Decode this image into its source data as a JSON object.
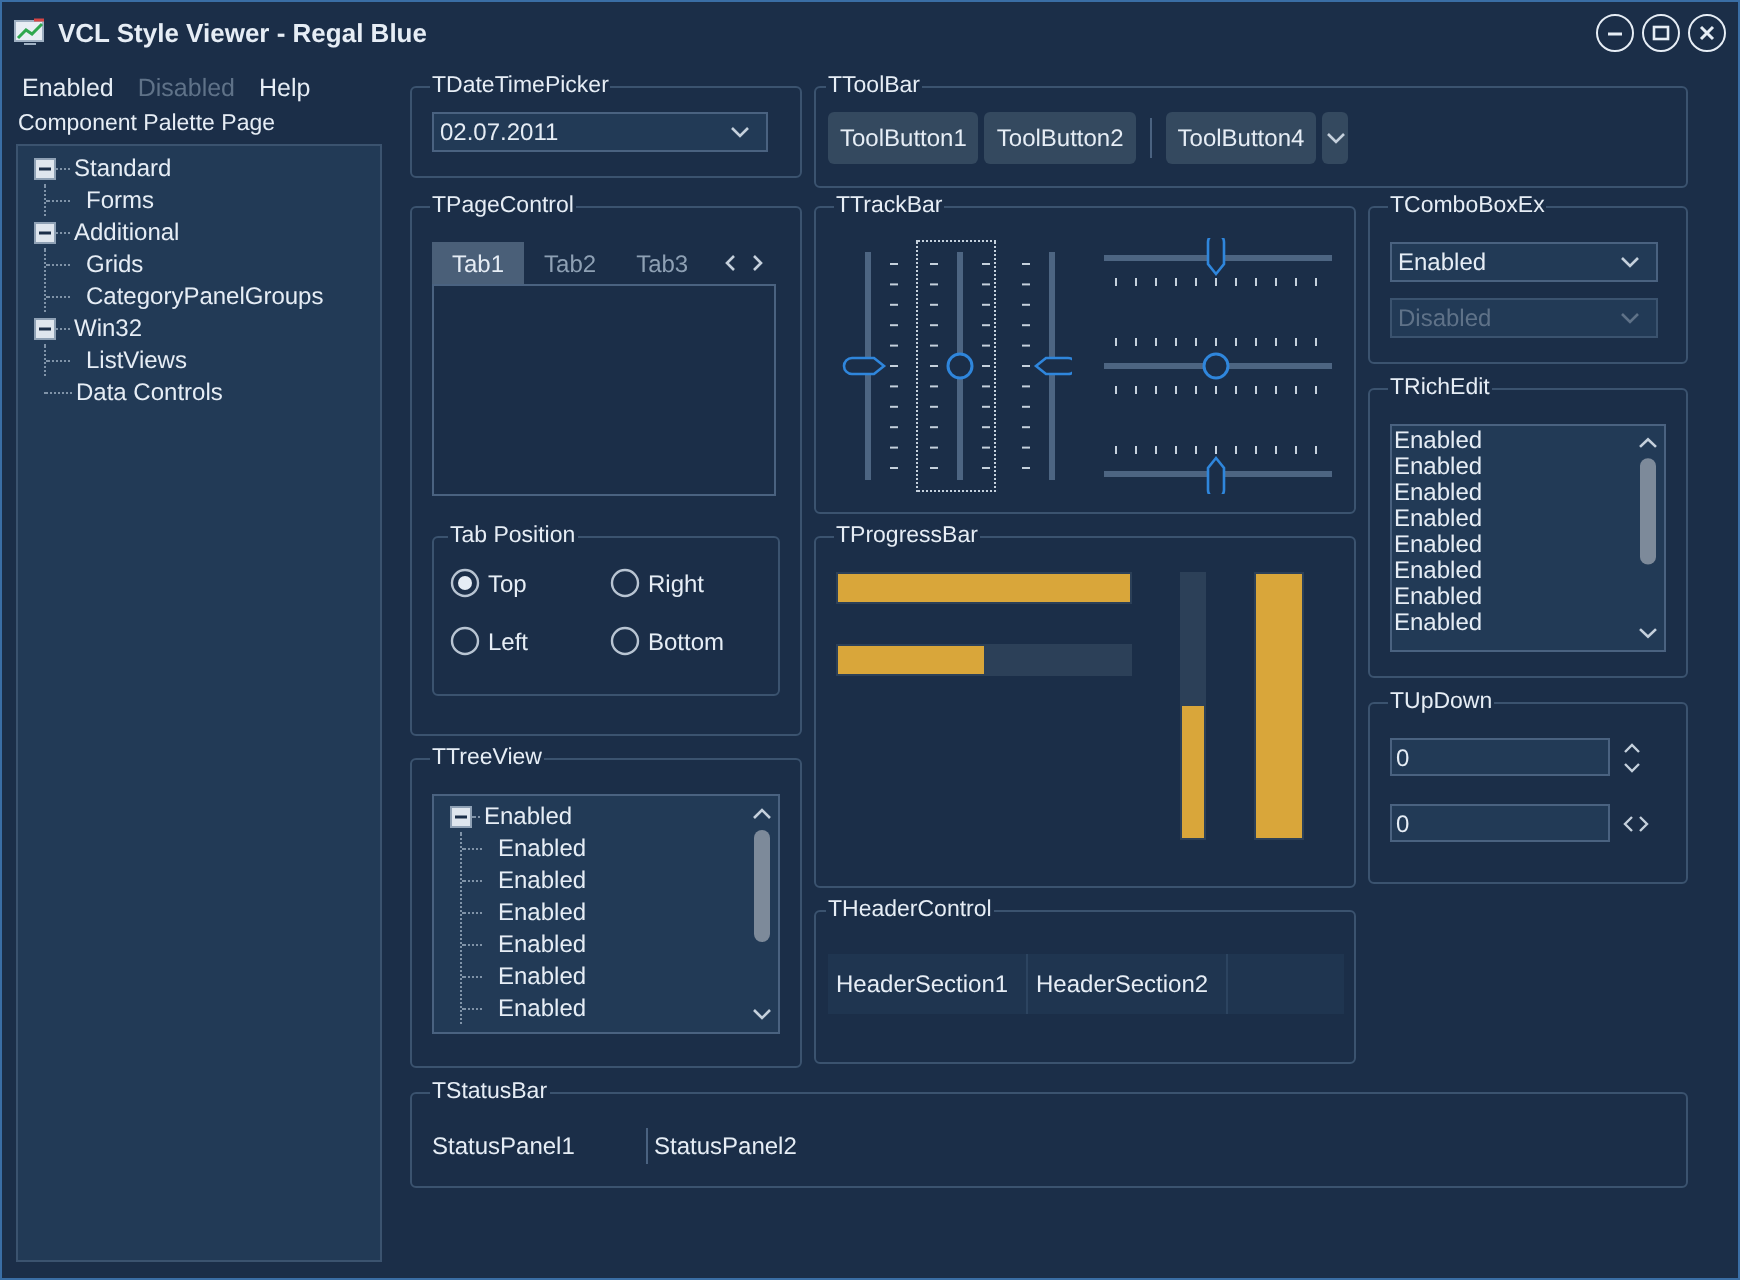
{
  "window": {
    "title": "VCL Style Viewer - Regal Blue"
  },
  "menu": [
    {
      "label": "Enabled",
      "disabled": false
    },
    {
      "label": "Disabled",
      "disabled": true
    },
    {
      "label": "Help",
      "disabled": false
    }
  ],
  "sidebar": {
    "label": "Component Palette Page",
    "items": [
      {
        "label": "Standard",
        "expanded": true,
        "children": [
          {
            "label": "Forms"
          }
        ]
      },
      {
        "label": "Additional",
        "expanded": true,
        "children": [
          {
            "label": "Grids"
          },
          {
            "label": "CategoryPanelGroups"
          }
        ]
      },
      {
        "label": "Win32",
        "expanded": true,
        "children": [
          {
            "label": "ListViews"
          }
        ]
      },
      {
        "label": "Data Controls"
      }
    ]
  },
  "date_time_picker": {
    "title": "TDateTimePicker",
    "value": "02.07.2011"
  },
  "toolbar": {
    "title": "TToolBar",
    "items": [
      {
        "kind": "button",
        "label": "ToolButton1"
      },
      {
        "kind": "button",
        "label": "ToolButton2"
      },
      {
        "kind": "separator"
      },
      {
        "kind": "button",
        "label": "ToolButton4"
      },
      {
        "kind": "dropdown"
      }
    ]
  },
  "page_control": {
    "title": "TPageControl",
    "tabs": [
      {
        "label": "Tab1",
        "selected": true
      },
      {
        "label": "Tab2",
        "selected": false
      },
      {
        "label": "Tab3",
        "selected": false
      }
    ],
    "tab_position": {
      "title": "Tab Position",
      "options": [
        {
          "label": "Top",
          "selected": true
        },
        {
          "label": "Right",
          "selected": false
        },
        {
          "label": "Left",
          "selected": false
        },
        {
          "label": "Bottom",
          "selected": false
        }
      ]
    }
  },
  "trackbar": {
    "title": "TTrackBar",
    "vertical": [
      {
        "kind": "ticks-after",
        "level": 0.5,
        "focused": false
      },
      {
        "kind": "ticks-both",
        "level": 0.5,
        "focused": true
      },
      {
        "kind": "ticks-before",
        "level": 0.5,
        "focused": false
      }
    ],
    "horizontal": [
      {
        "kind": "ticks-after",
        "level": 0.5
      },
      {
        "kind": "ticks-both",
        "level": 0.5
      },
      {
        "kind": "ticks-before",
        "level": 0.5
      }
    ]
  },
  "combobox_ex": {
    "title": "TComboBoxEx",
    "items": [
      {
        "value": "Enabled",
        "disabled": false
      },
      {
        "value": "Disabled",
        "disabled": true
      }
    ]
  },
  "rich_edit": {
    "title": "TRichEdit",
    "lines": [
      "Enabled",
      "Enabled",
      "Enabled",
      "Enabled",
      "Enabled",
      "Enabled",
      "Enabled",
      "Enabled"
    ]
  },
  "progress_bar": {
    "title": "TProgressBar",
    "horizontal": [
      {
        "level": 1.0
      },
      {
        "level": 0.5
      }
    ],
    "vertical": [
      {
        "level": 0.5
      },
      {
        "level": 1.0
      }
    ]
  },
  "up_down": {
    "title": "TUpDown",
    "items": [
      {
        "kind": "vertical",
        "value": "0"
      },
      {
        "kind": "horizontal",
        "value": "0"
      }
    ]
  },
  "tree_view": {
    "title": "TTreeView",
    "items": [
      {
        "label": "Enabled",
        "expanded": true,
        "children": [
          {
            "label": "Enabled"
          },
          {
            "label": "Enabled"
          },
          {
            "label": "Enabled"
          },
          {
            "label": "Enabled"
          },
          {
            "label": "Enabled"
          },
          {
            "label": "Enabled"
          }
        ]
      }
    ]
  },
  "header_control": {
    "title": "THeaderControl",
    "sections": [
      "HeaderSection1",
      "HeaderSection2"
    ]
  },
  "status_bar": {
    "title": "TStatusBar",
    "panels": [
      "StatusPanel1",
      "StatusPanel2"
    ]
  }
}
